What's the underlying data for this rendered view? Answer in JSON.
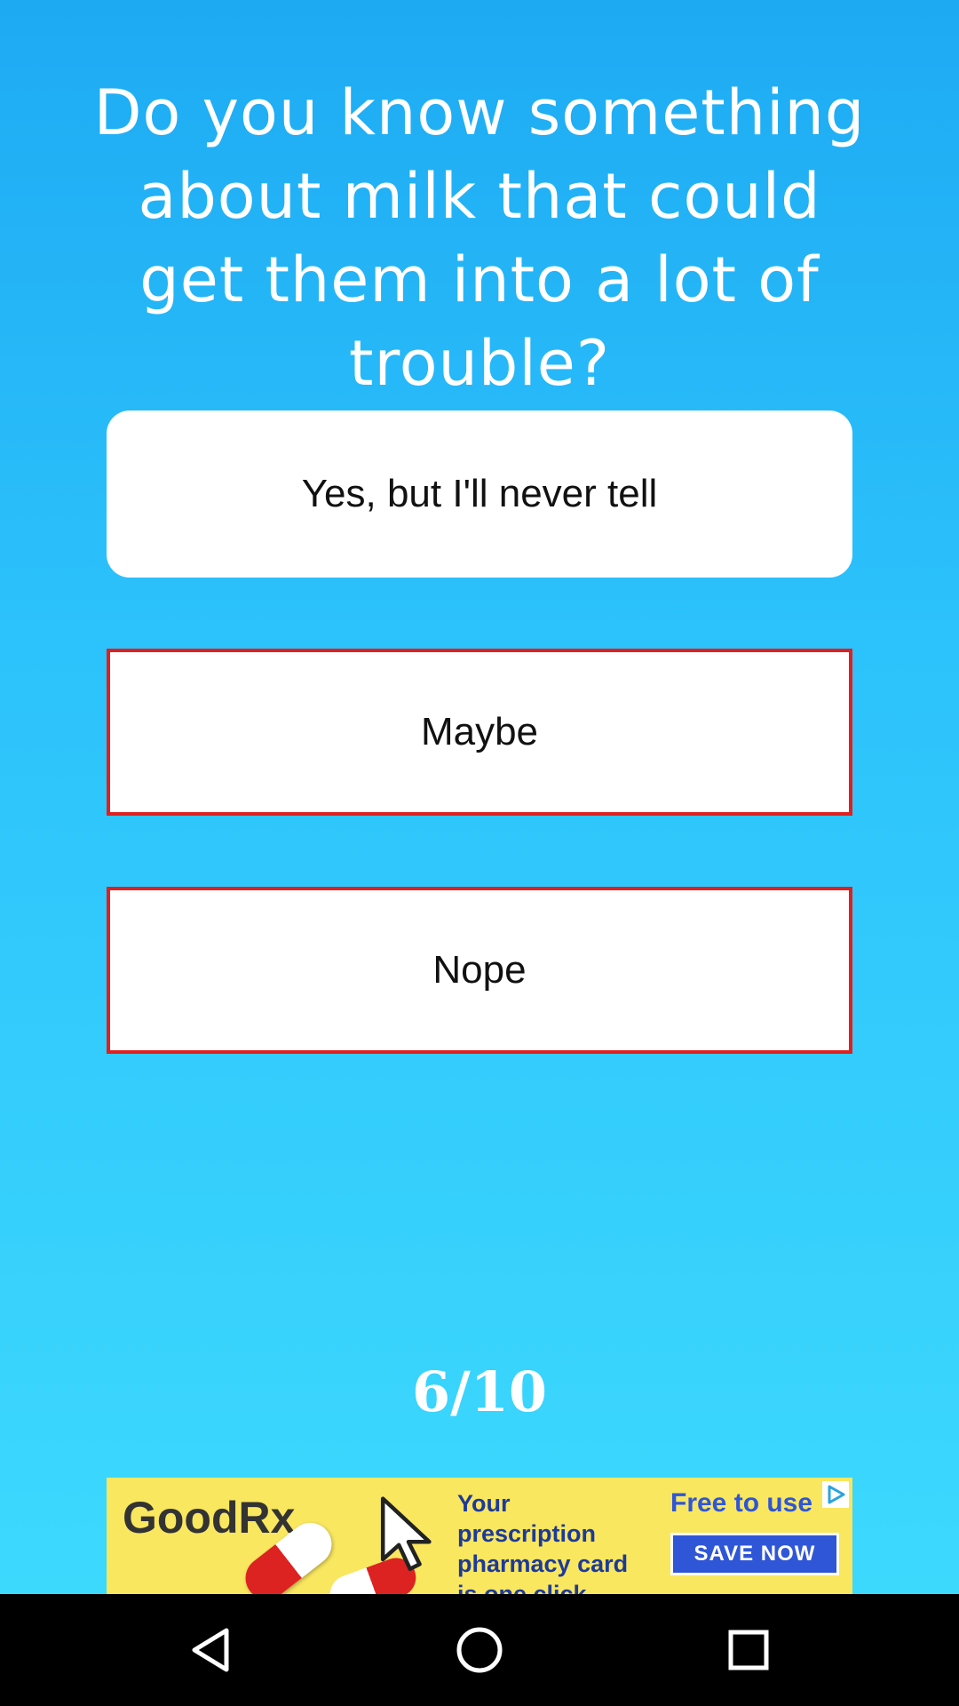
{
  "question": {
    "text": "Do you know something about milk that could get them into a lot of trouble?"
  },
  "answers": [
    {
      "label": "Yes, but I'll never tell",
      "state": "default"
    },
    {
      "label": "Maybe",
      "state": "wrong"
    },
    {
      "label": "Nope",
      "state": "wrong"
    }
  ],
  "progress": {
    "text": "6/10",
    "current": 6,
    "total": 10
  },
  "ad": {
    "brand": "GoodRx",
    "text": "Your prescription pharmacy card is one click away.",
    "free_text": "Free to use",
    "cta": "SAVE NOW"
  },
  "navbar": {
    "back_icon": "back-triangle",
    "home_icon": "home-circle",
    "recent_icon": "recents-square"
  },
  "colors": {
    "background_top": "#1eaaf3",
    "background_bottom": "#3dd9fd",
    "wrong_border": "#e02020",
    "ad_background": "#f9e760",
    "ad_accent": "#2f56d6"
  }
}
